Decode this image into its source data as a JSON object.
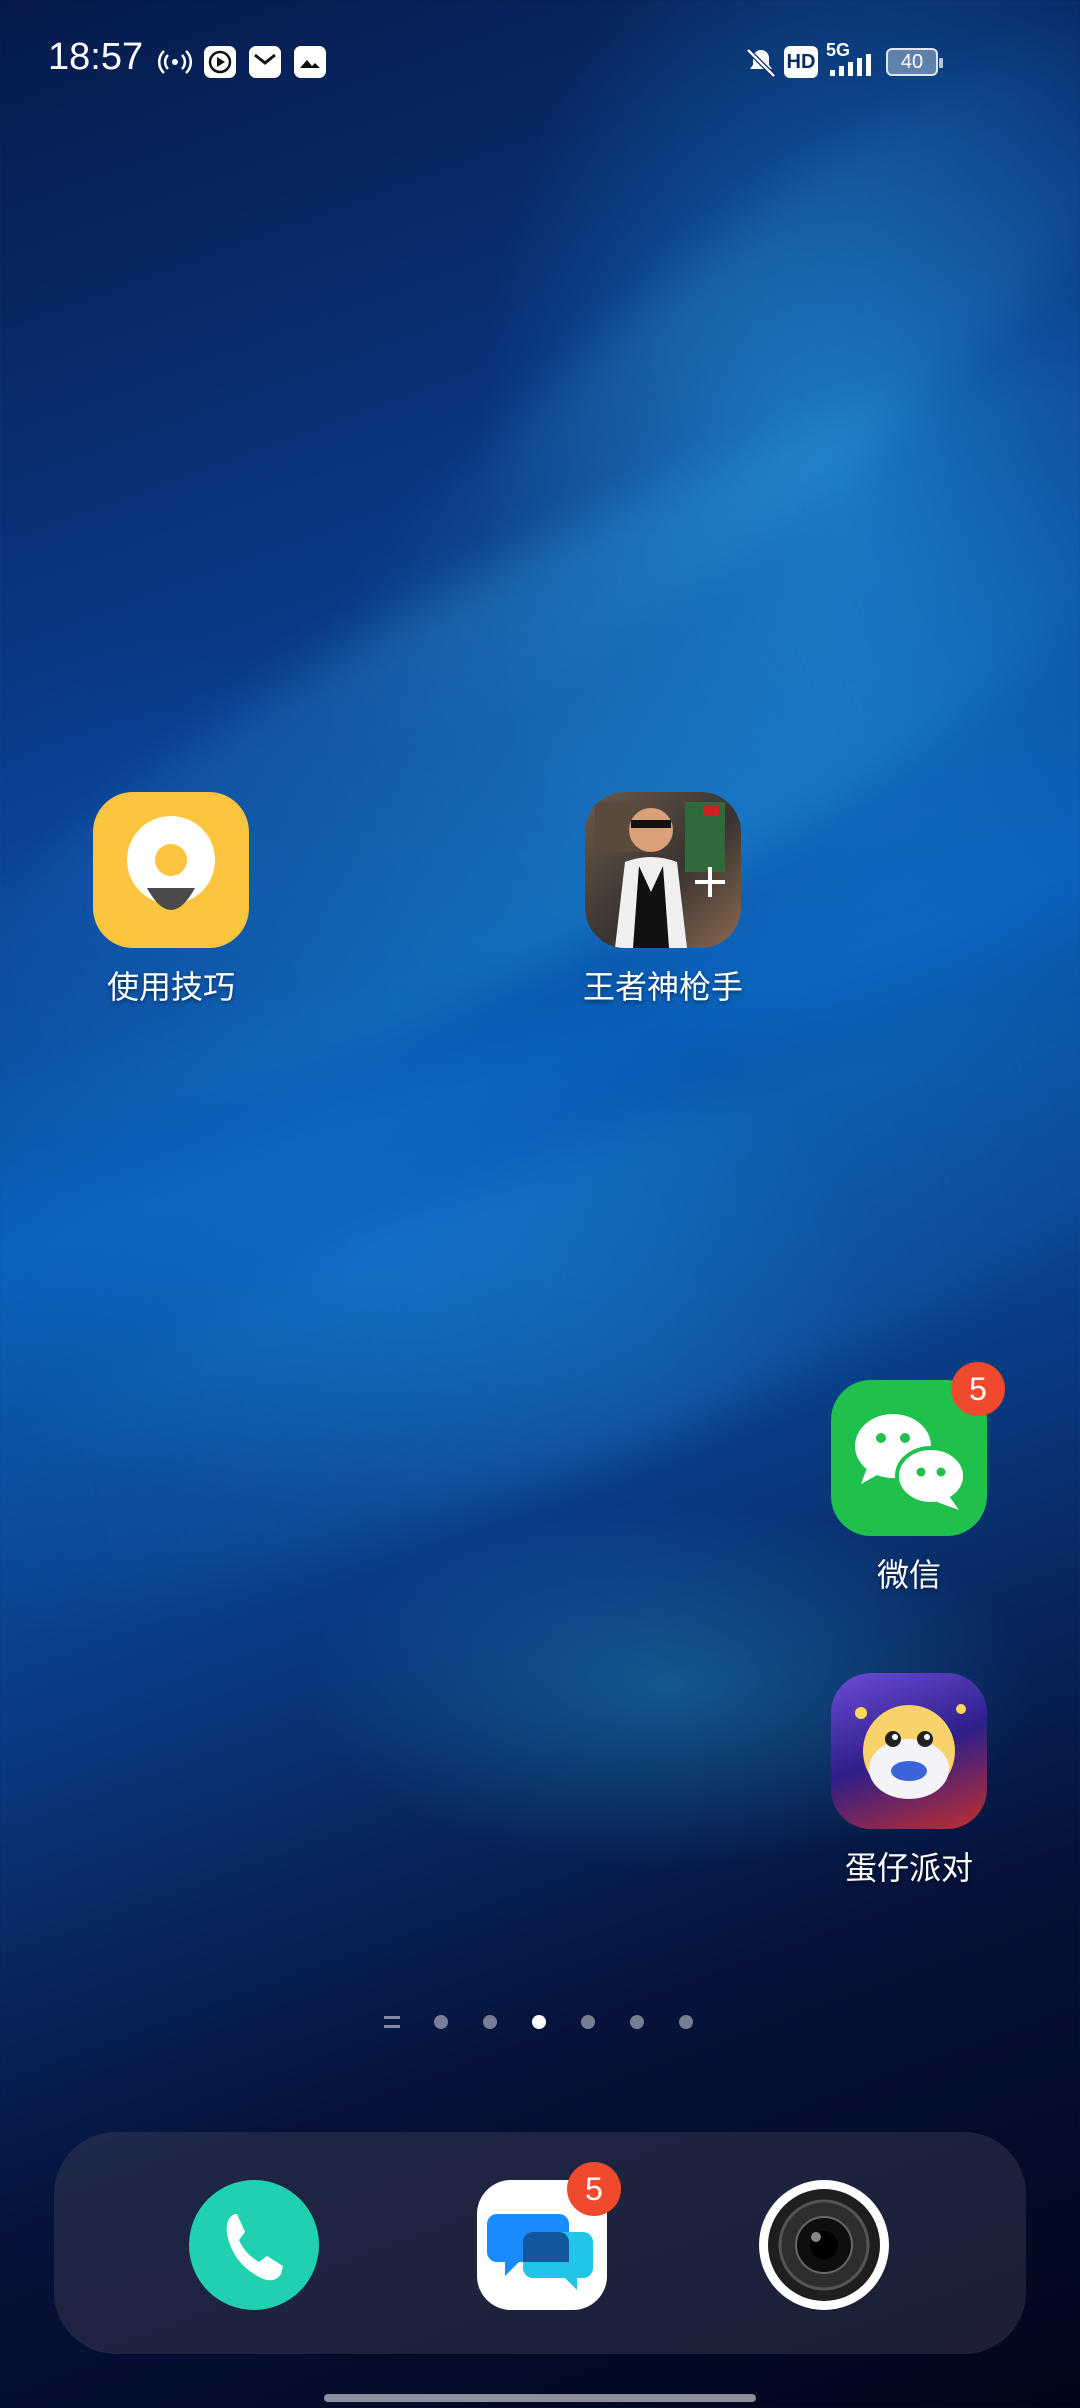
{
  "status_bar": {
    "time": "18:57",
    "icons": [
      "hotspot-icon",
      "video-icon",
      "mail-icon",
      "photo-icon"
    ],
    "right_icons": [
      "mute-bell-icon",
      "hd-icon",
      "signal-5g-icon"
    ],
    "hd_label": "HD",
    "network_label": "5G",
    "battery_level": "40"
  },
  "home_apps": [
    {
      "label": "使用技巧",
      "icon": "tips-bulb-icon"
    },
    {
      "label": "王者神枪手",
      "icon": "sniper-game-icon"
    },
    {
      "label": "微信",
      "icon": "wechat-icon",
      "badge": "5"
    },
    {
      "label": "蛋仔派对",
      "icon": "eggy-party-icon"
    }
  ],
  "pager": {
    "page_count": 6,
    "active_index": 2
  },
  "dock": [
    {
      "name": "phone",
      "icon": "phone-icon"
    },
    {
      "name": "messages",
      "icon": "message-icon",
      "badge": "5"
    },
    {
      "name": "camera",
      "icon": "camera-icon"
    }
  ],
  "colors": {
    "badge": "#f04a2e",
    "tips": "#fcc43f",
    "wechat": "#1fc14c",
    "phone": "#20d1b0",
    "message": "#1a8cff"
  }
}
